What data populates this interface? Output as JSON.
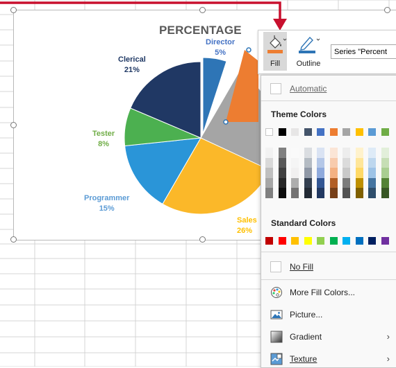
{
  "chart": {
    "title": "PERCENTAGE",
    "slices": [
      {
        "name": "Director",
        "percent": "5%",
        "label_color": "#4472C4",
        "color": "#2E75B6"
      },
      {
        "name": "Clerical",
        "percent": "21%",
        "label_color": "#1F3864",
        "color": "#203864"
      },
      {
        "name": "Tester",
        "percent": "8%",
        "label_color": "#70AD47",
        "color": "#4CB050"
      },
      {
        "name": "Programmer",
        "percent": "15%",
        "label_color": "#5B9BD5",
        "color": "#2A95D8"
      },
      {
        "name": "Sales",
        "percent": "26%",
        "label_color": "#FFC000",
        "color": "#FBB829"
      }
    ],
    "orange_slice_color": "#ED7D31",
    "gray_slice_color": "#A5A5A5"
  },
  "ribbon": {
    "fill_label": "Fill",
    "outline_label": "Outline",
    "series_box": "Series \"Percent"
  },
  "menu": {
    "automatic": "Automatic",
    "theme_colors": "Theme Colors",
    "standard_colors": "Standard Colors",
    "no_fill": "No Fill",
    "more_fill_colors": "More Fill Colors...",
    "picture": "Picture...",
    "gradient": "Gradient",
    "texture": "Texture"
  },
  "theme_colors_top": [
    "#FFFFFF",
    "#000000",
    "#E7E6E6",
    "#44546A",
    "#4472C4",
    "#ED7D31",
    "#A5A5A5",
    "#FFC000",
    "#5B9BD5",
    "#70AD47"
  ],
  "standard_colors": [
    "#C00000",
    "#FF0000",
    "#FFC000",
    "#FFFF00",
    "#92D050",
    "#00B050",
    "#00B0F0",
    "#0070C0",
    "#002060",
    "#7030A0"
  ],
  "colors": {
    "accent_red": "#C00000"
  }
}
